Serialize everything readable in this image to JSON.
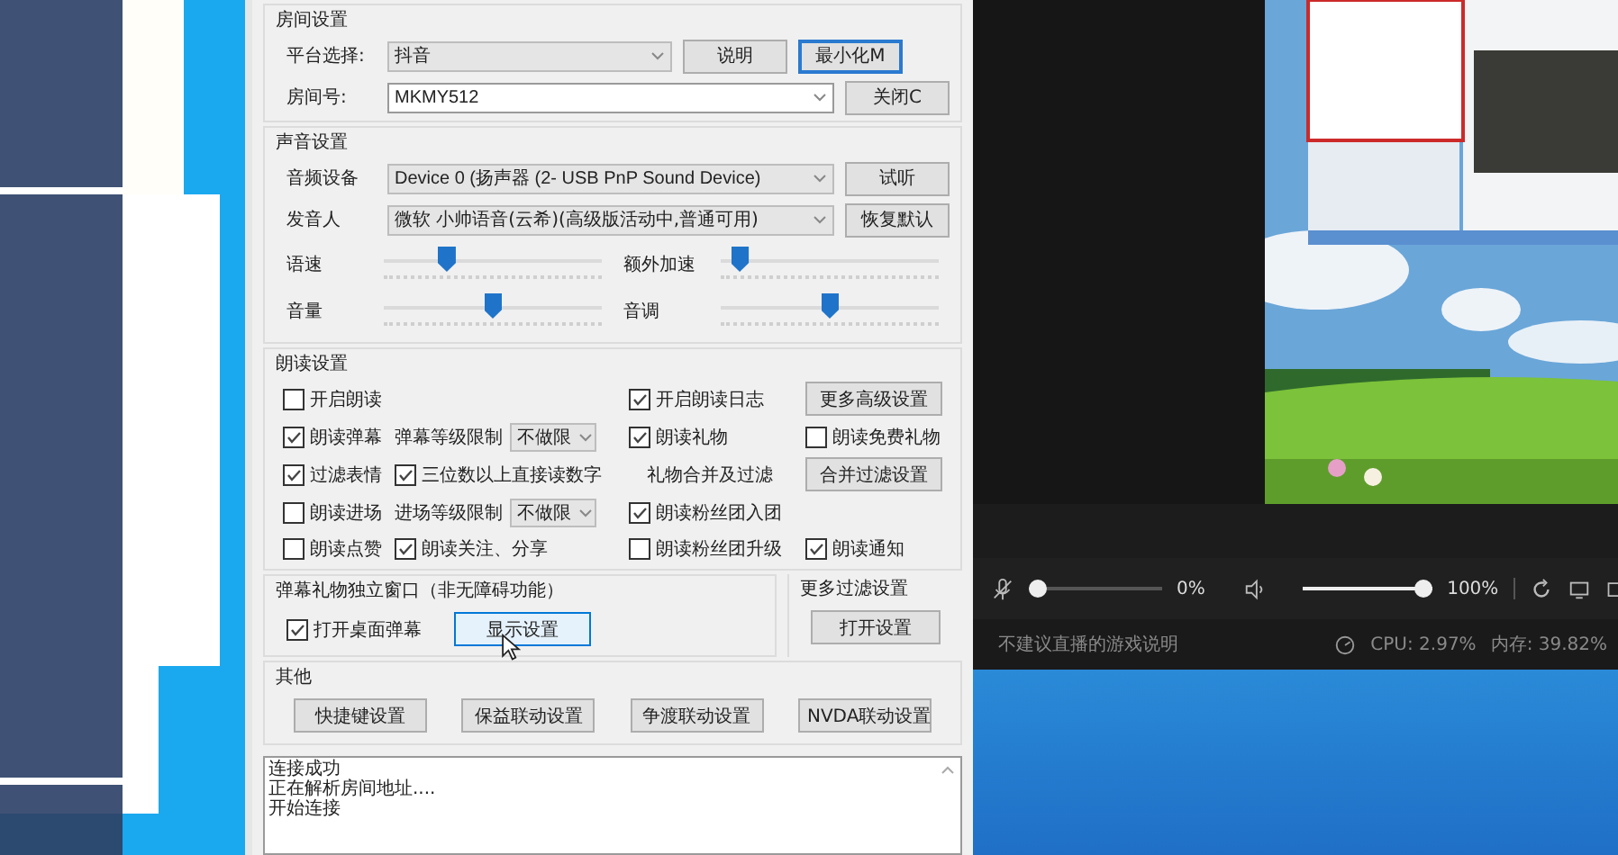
{
  "room_settings": {
    "title": "房间设置",
    "platform_label": "平台选择:",
    "platform": "抖音",
    "help_button": "说明",
    "minimize_button": "最小化M",
    "room_label": "房间号:",
    "room_id": "MKMY512",
    "close_button": "关闭C"
  },
  "sound_settings": {
    "title": "声音设置",
    "device_label": "音频设备",
    "device": "Device 0 (扬声器 (2- USB PnP Sound Device)",
    "test_button": "试听",
    "voice_label": "发音人",
    "voice": "微软 小帅语音(云希)(高级版活动中,普通可用)",
    "reset_button": "恢复默认",
    "sliders": [
      {
        "label": "语速",
        "level": 0.27
      },
      {
        "label": "额外加速",
        "level": 0.05
      },
      {
        "label": "音量",
        "level": 0.5
      },
      {
        "label": "音调",
        "level": 0.5
      }
    ]
  },
  "reading_settings": {
    "title": "朗读设置",
    "rows": [
      [
        {
          "kind": "checkbox",
          "label": "开启朗读",
          "checked": false
        },
        {
          "kind": "spacer"
        },
        {
          "kind": "checkbox",
          "label": "开启朗读日志",
          "checked": true
        },
        {
          "kind": "button",
          "label": "更多高级设置"
        }
      ],
      [
        {
          "kind": "checkbox",
          "label": "朗读弹幕",
          "checked": true
        },
        {
          "kind": "limit",
          "label": "弹幕等级限制",
          "value": "不做限"
        },
        {
          "kind": "checkbox",
          "label": "朗读礼物",
          "checked": true
        },
        {
          "kind": "checkbox",
          "label": "朗读免费礼物",
          "checked": false
        }
      ],
      [
        {
          "kind": "checkbox",
          "label": "过滤表情",
          "checked": true
        },
        {
          "kind": "checkbox",
          "label": "三位数以上直接读数字",
          "checked": true
        },
        {
          "kind": "text",
          "label": "礼物合并及过滤"
        },
        {
          "kind": "button",
          "label": "合并过滤设置"
        }
      ],
      [
        {
          "kind": "checkbox",
          "label": "朗读进场",
          "checked": false
        },
        {
          "kind": "limit",
          "label": "进场等级限制",
          "value": "不做限"
        },
        {
          "kind": "checkbox",
          "label": "朗读粉丝团入团",
          "checked": true
        }
      ],
      [
        {
          "kind": "checkbox",
          "label": "朗读点赞",
          "checked": false
        },
        {
          "kind": "checkbox",
          "label": "朗读关注、分享",
          "checked": true
        },
        {
          "kind": "checkbox",
          "label": "朗读粉丝团升级",
          "checked": false
        },
        {
          "kind": "checkbox",
          "label": "朗读通知",
          "checked": true
        }
      ]
    ]
  },
  "popup_window": {
    "title": "弹幕礼物独立窗口（非无障碍功能）",
    "desktop_danmaku": {
      "label": "打开桌面弹幕",
      "checked": true
    },
    "display_button": {
      "label": "显示设置",
      "hovered": true
    }
  },
  "more_filters": {
    "title": "更多过滤设置",
    "button": "打开设置"
  },
  "other": {
    "title": "其他",
    "buttons": [
      "快捷键设置",
      "保益联动设置",
      "争渡联动设置",
      "NVDA联动设置"
    ]
  },
  "log": {
    "lines": [
      "连接成功",
      "正在解析房间地址....",
      "开始连接"
    ]
  },
  "audio_bar": {
    "mic": {
      "muted": true,
      "level": 0,
      "reading": "0%"
    },
    "speaker": {
      "level": 1,
      "reading": "100%"
    }
  },
  "status_bar": {
    "notice": "不建议直播的游戏说明",
    "cpu": "CPU: 2.97%",
    "memory": "内存: 39.82%"
  }
}
